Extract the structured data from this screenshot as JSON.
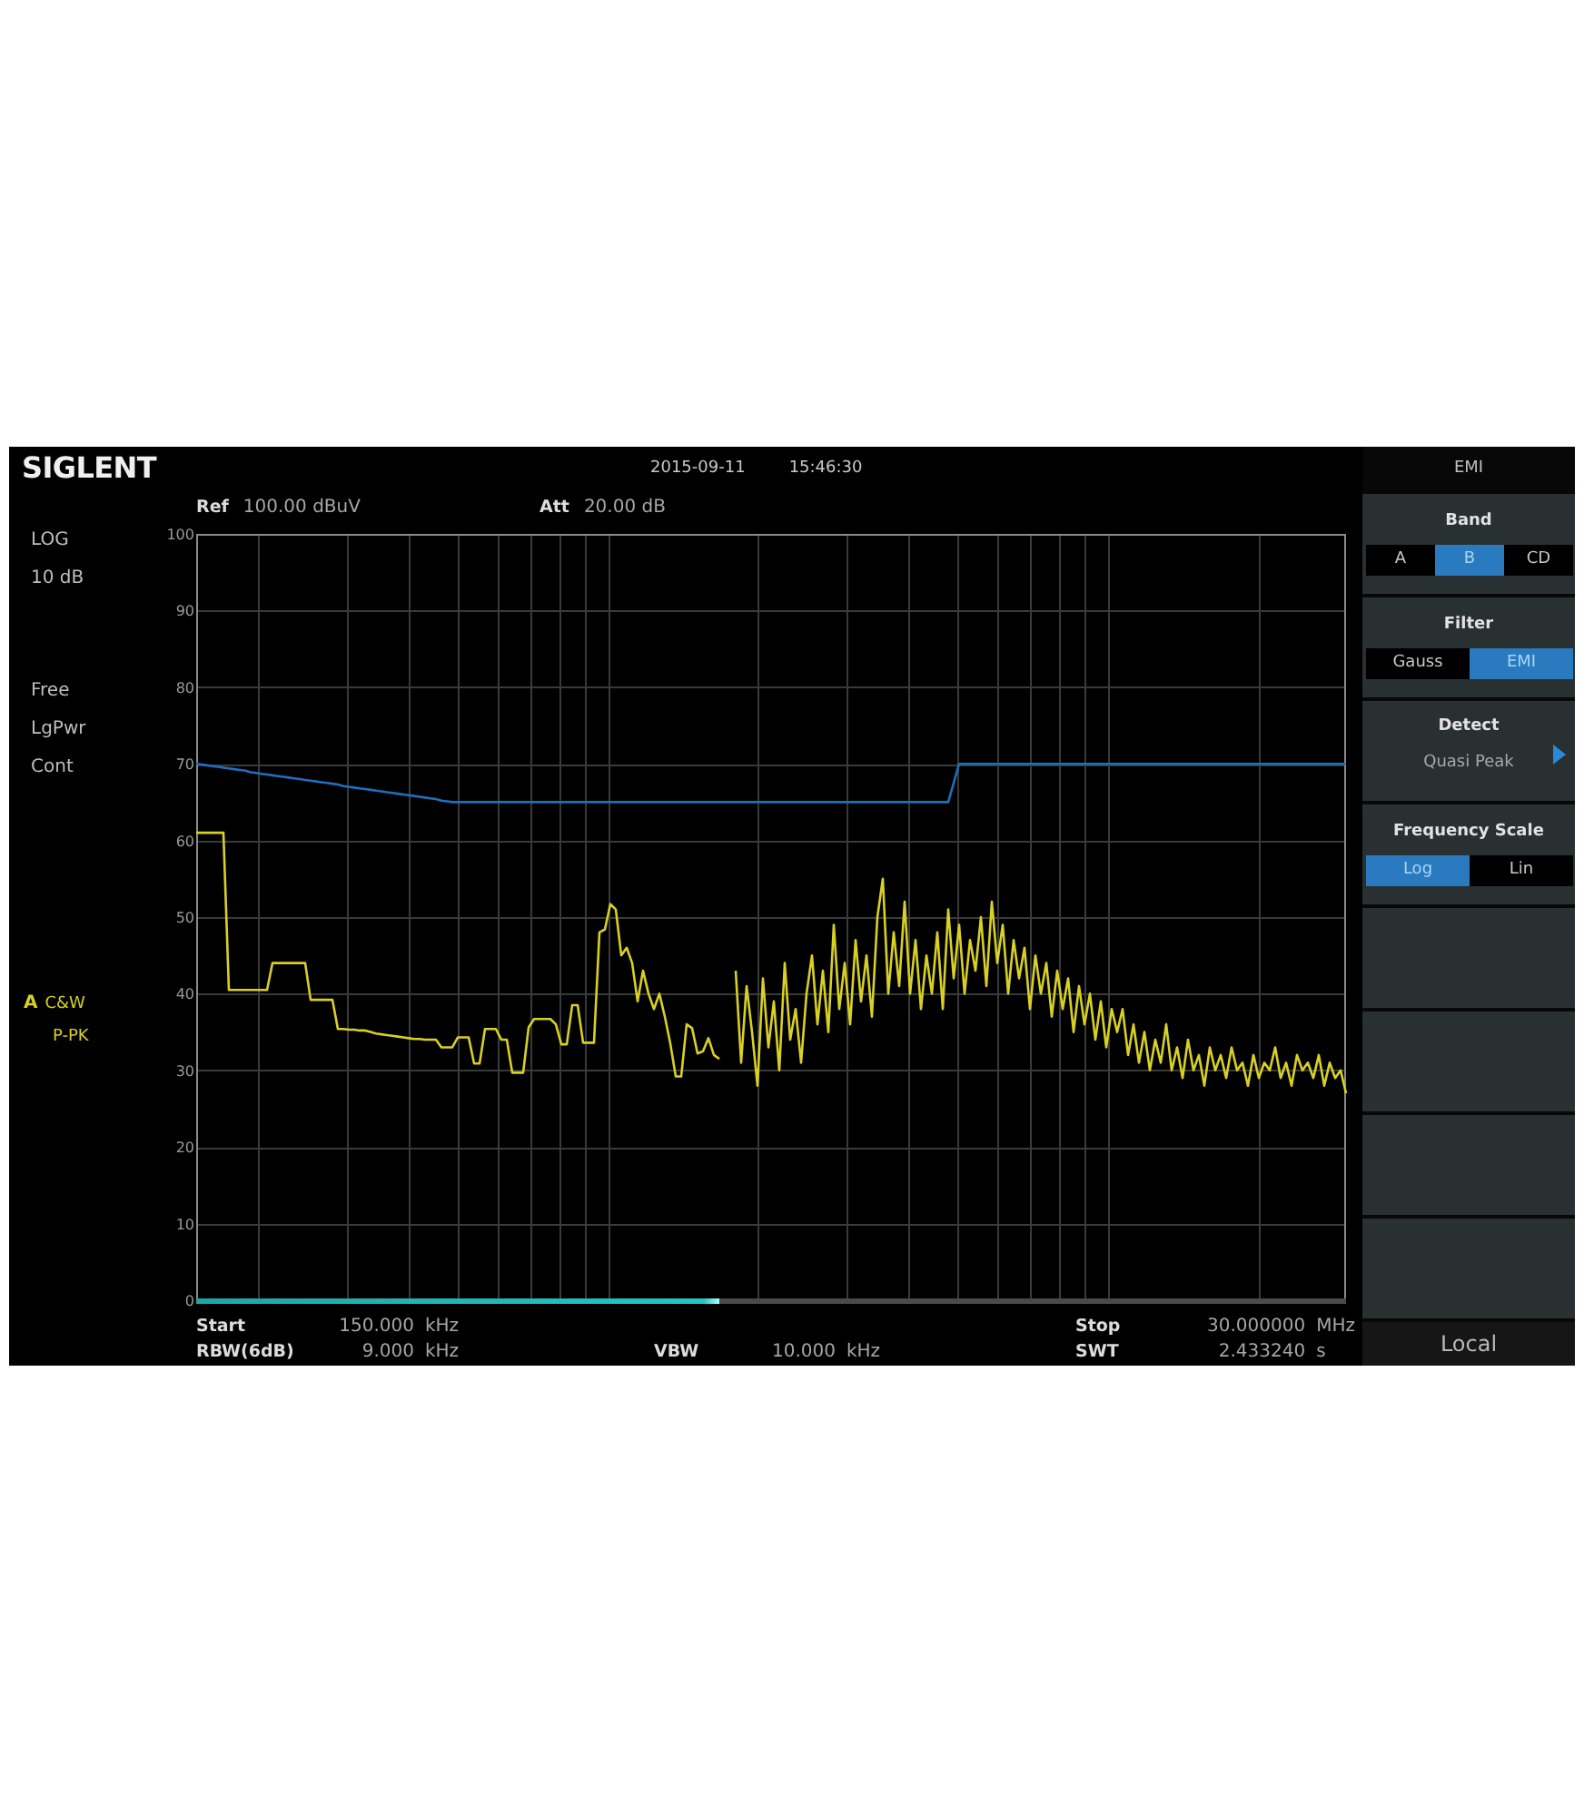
{
  "top_bar": {
    "brand": "SIGLENT",
    "date": "2015-09-11",
    "time": "15:46:30"
  },
  "status_panel": {
    "scale": [
      "LOG",
      "10 dB"
    ],
    "modes": [
      "Free",
      "LgPwr",
      "Cont"
    ],
    "trace": {
      "name": "A",
      "lines": [
        "C&W",
        "P-PK"
      ]
    }
  },
  "header_readouts": [
    {
      "label": "Ref",
      "value": "100.00 dBuV"
    },
    {
      "label": "Att",
      "value": "20.00 dB"
    }
  ],
  "spectrum": {
    "chart_data": {
      "type": "line",
      "grid": true,
      "ylim": [
        0,
        100
      ],
      "yticks": [
        0,
        10,
        20,
        30,
        40,
        50,
        60,
        70,
        80,
        90,
        100
      ],
      "categories": [
        null,
        null,
        null,
        null,
        null,
        null,
        null,
        null,
        null,
        null,
        null,
        null,
        null,
        null,
        null,
        null,
        null,
        null,
        null,
        null,
        null,
        null,
        null,
        null,
        null,
        null,
        null,
        null,
        null,
        null,
        null,
        null,
        null,
        null,
        null,
        null,
        null,
        null,
        null,
        null,
        null,
        null,
        null,
        null,
        null,
        null,
        null,
        null,
        null,
        null,
        null,
        null,
        null,
        null,
        null,
        null,
        null,
        null,
        null,
        null,
        null,
        null,
        null,
        null,
        null,
        null,
        null,
        null,
        null,
        null,
        null,
        null,
        null,
        null,
        null,
        null,
        null,
        null,
        null,
        null,
        null,
        null,
        null,
        null,
        null,
        null,
        null,
        null,
        null,
        null,
        null,
        null,
        null,
        null,
        null,
        null,
        null,
        null,
        null,
        null,
        null,
        null,
        null,
        null,
        null,
        null,
        null,
        null,
        null,
        null,
        null,
        null,
        null,
        null,
        null,
        null,
        null,
        null,
        null,
        null,
        null,
        null,
        null,
        null,
        null,
        null,
        null,
        null,
        null,
        null,
        null,
        null,
        null,
        null,
        null,
        null,
        null,
        null,
        null,
        null,
        null,
        null,
        null,
        null,
        null,
        null,
        null,
        null,
        null,
        null,
        null,
        null,
        null,
        null,
        null,
        null,
        null,
        null,
        null,
        null,
        null,
        null,
        null,
        null,
        null,
        null,
        null,
        null,
        null,
        null,
        null,
        null,
        null,
        null,
        null,
        null,
        null,
        null,
        null,
        null,
        null,
        null,
        null,
        null,
        null,
        null,
        null,
        null,
        null,
        null,
        null,
        null,
        null,
        null,
        null,
        null,
        null,
        null,
        null,
        null,
        null,
        null,
        null,
        null,
        null,
        null,
        null,
        null,
        null,
        null,
        null,
        null
      ],
      "series": [
        {
          "color": "#d8d024",
          "values": [
            61,
            61,
            61,
            61,
            61,
            61,
            40.5,
            40.5,
            40.5,
            40.5,
            40.5,
            40.5,
            40.5,
            40.5,
            44,
            44,
            44,
            44,
            44,
            44,
            44,
            39.2,
            39.2,
            39.2,
            39.2,
            39.2,
            35.4,
            35.4,
            35.3,
            35.3,
            35.2,
            35.2,
            35,
            34.8,
            34.7,
            34.6,
            34.5,
            34.4,
            34.3,
            34.2,
            34.1,
            34.1,
            34,
            34,
            34,
            33,
            33,
            33,
            34.3,
            34.3,
            34.3,
            30.9,
            30.9,
            35.4,
            35.4,
            35.4,
            34,
            34,
            29.7,
            29.7,
            29.7,
            35.6,
            36.7,
            36.7,
            36.7,
            36.7,
            36,
            33.4,
            33.4,
            38.5,
            38.5,
            33.6,
            33.6,
            33.6,
            48,
            48.4,
            51.7,
            51,
            45,
            46,
            44,
            39,
            43,
            40,
            38,
            40,
            37,
            33.5,
            29.2,
            29.2,
            36,
            35.5,
            32.2,
            32.5,
            34.2,
            32,
            31.5,
            null,
            null,
            43,
            31,
            41,
            35,
            28,
            42,
            33,
            39,
            30,
            44,
            34,
            38,
            31,
            40,
            45,
            36,
            43,
            35,
            49,
            38,
            44,
            36,
            47,
            39,
            45,
            37,
            50,
            55,
            40,
            48,
            41,
            52,
            40,
            47,
            38,
            45,
            40,
            48,
            38,
            51,
            42,
            49,
            40,
            47,
            43,
            50,
            41,
            52,
            44,
            49,
            40,
            47,
            42,
            46,
            38,
            45,
            40,
            44,
            37,
            43,
            38,
            42,
            35,
            41,
            36,
            40,
            34,
            39,
            33,
            38,
            35,
            38,
            32,
            36,
            31,
            35,
            30,
            34,
            31,
            36,
            30,
            33,
            29,
            34,
            30,
            32,
            28,
            33,
            30,
            32,
            29,
            33,
            30,
            31,
            28,
            32,
            29,
            31,
            30,
            33,
            29,
            31,
            28,
            32,
            30,
            31,
            29,
            32,
            28,
            31,
            29,
            30,
            27
          ]
        },
        {
          "color": "#1f6fbf",
          "values": [
            70,
            69.9,
            69.8,
            69.7,
            69.6,
            69.5,
            69.4,
            69.3,
            69.2,
            69.1,
            68.9,
            68.8,
            68.7,
            68.6,
            68.5,
            68.4,
            68.3,
            68.2,
            68.1,
            68,
            67.9,
            67.8,
            67.7,
            67.6,
            67.5,
            67.4,
            67.3,
            67.1,
            67,
            66.9,
            66.8,
            66.7,
            66.6,
            66.5,
            66.4,
            66.3,
            66.2,
            66.1,
            66,
            65.9,
            65.8,
            65.7,
            65.6,
            65.5,
            65.4,
            65.2,
            65.1,
            65,
            65,
            65,
            65,
            65,
            65,
            65,
            65,
            65,
            65,
            65,
            65,
            65,
            65,
            65,
            65,
            65,
            65,
            65,
            65,
            65,
            65,
            65,
            65,
            65,
            65,
            65,
            65,
            65,
            65,
            65,
            65,
            65,
            65,
            65,
            65,
            65,
            65,
            65,
            65,
            65,
            65,
            65,
            65,
            65,
            65,
            65,
            65,
            65,
            65,
            65,
            65,
            65,
            65,
            65,
            65,
            65,
            65,
            65,
            65,
            65,
            65,
            65,
            65,
            65,
            65,
            65,
            65,
            65,
            65,
            65,
            65,
            65,
            65,
            65,
            65,
            65,
            65,
            65,
            65,
            65,
            65,
            65,
            65,
            65,
            65,
            65,
            65,
            65,
            65,
            65,
            65,
            67.5,
            70,
            70,
            70,
            70,
            70,
            70,
            70,
            70,
            70,
            70,
            70,
            70,
            70,
            70,
            70,
            70,
            70,
            70,
            70,
            70,
            70,
            70,
            70,
            70,
            70,
            70,
            70,
            70,
            70,
            70,
            70,
            70,
            70,
            70,
            70,
            70,
            70,
            70,
            70,
            70,
            70,
            70,
            70,
            70,
            70,
            70,
            70,
            70,
            70,
            70,
            70,
            70,
            70,
            70,
            70,
            70,
            70,
            70,
            70,
            70,
            70,
            70,
            70,
            70,
            70,
            70,
            70,
            70,
            70,
            70,
            70,
            70
          ]
        }
      ]
    },
    "sweep_progress": {
      "level": 0.455
    }
  },
  "footer_readouts": {
    "left": [
      {
        "label": "Start",
        "value": "150.000",
        "unit": "kHz"
      },
      {
        "label": "RBW(6dB)",
        "value": "9.000",
        "unit": "kHz"
      }
    ],
    "middle": [
      {
        "label": "VBW",
        "value": "10.000",
        "unit": "kHz"
      }
    ],
    "right": [
      {
        "label": "Stop",
        "value": "30.000000",
        "unit": "MHz"
      },
      {
        "label": "SWT",
        "value": "2.433240",
        "unit": "s"
      }
    ]
  },
  "softkey_menu": {
    "title": "EMI",
    "items": [
      {
        "kind": "choice",
        "label": "Band",
        "options": [
          {
            "label": "A",
            "selected": false
          },
          {
            "label": "B",
            "selected": true
          },
          {
            "label": "CD",
            "selected": false
          }
        ]
      },
      {
        "kind": "choice",
        "label": "Filter",
        "options": [
          {
            "label": "Gauss",
            "selected": false
          },
          {
            "label": "EMI",
            "selected": true
          }
        ]
      },
      {
        "kind": "submenu",
        "label": "Detect",
        "value": "Quasi Peak"
      },
      {
        "kind": "choice",
        "label": "Frequency Scale",
        "options": [
          {
            "label": "Log",
            "selected": true
          },
          {
            "label": "Lin",
            "selected": false
          }
        ]
      },
      {
        "kind": "blank"
      },
      {
        "kind": "blank"
      },
      {
        "kind": "blank"
      },
      {
        "kind": "blank"
      }
    ],
    "status": "Local"
  }
}
